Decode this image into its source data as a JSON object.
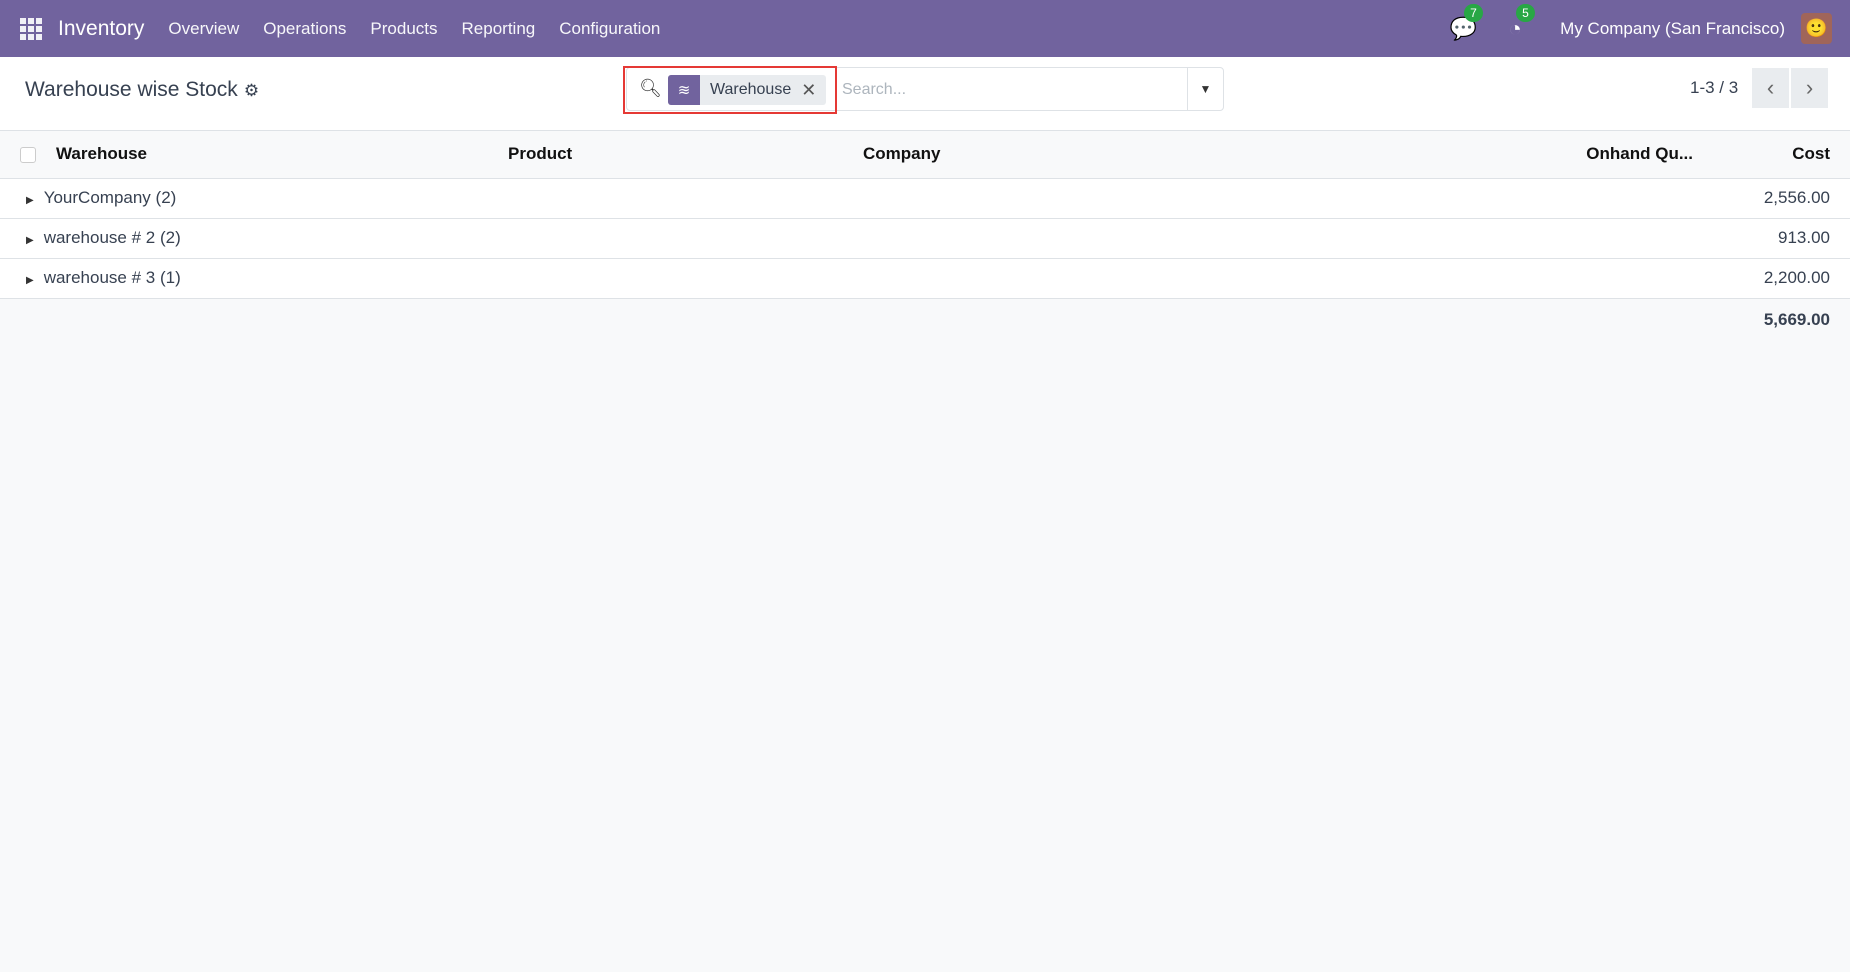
{
  "nav": {
    "app": "Inventory",
    "menu": [
      "Overview",
      "Operations",
      "Products",
      "Reporting",
      "Configuration"
    ],
    "messages_count": "7",
    "activities_count": "5",
    "company": "My Company (San Francisco)"
  },
  "control": {
    "title": "Warehouse wise Stock",
    "facet": "Warehouse",
    "search_placeholder": "Search...",
    "pager": "1-3 / 3"
  },
  "table": {
    "headers": [
      "Warehouse",
      "Product",
      "Company",
      "Onhand Qu...",
      "Cost"
    ],
    "groups": [
      {
        "label": "YourCompany (2)",
        "cost": "2,556.00"
      },
      {
        "label": "warehouse # 2 (2)",
        "cost": "913.00"
      },
      {
        "label": "warehouse # 3 (1)",
        "cost": "2,200.00"
      }
    ],
    "total_cost": "5,669.00"
  },
  "colors": {
    "brand": "#71639e",
    "badge": "#28a745",
    "highlight": "#e53935"
  }
}
